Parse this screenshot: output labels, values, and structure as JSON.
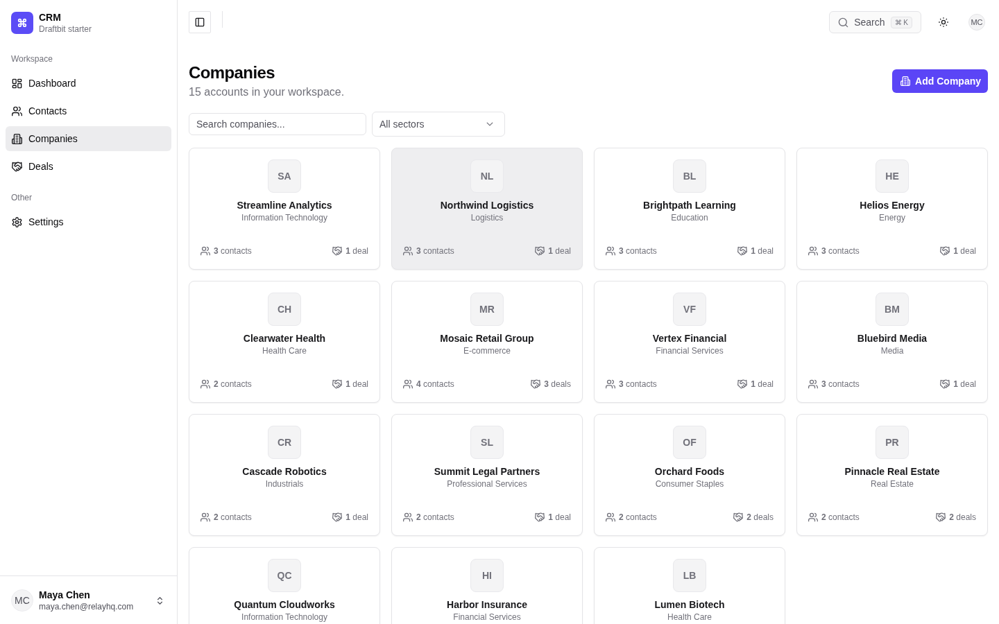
{
  "sidebar": {
    "brand": {
      "title": "CRM",
      "subtitle": "Draftbit starter"
    },
    "sections": [
      {
        "label": "Workspace",
        "items": [
          {
            "label": "Dashboard",
            "selected": false
          },
          {
            "label": "Contacts",
            "selected": false
          },
          {
            "label": "Companies",
            "selected": true
          },
          {
            "label": "Deals",
            "selected": false
          }
        ]
      },
      {
        "label": "Other",
        "items": [
          {
            "label": "Settings",
            "selected": false
          }
        ]
      }
    ],
    "user": {
      "initials": "MC",
      "name": "Maya Chen",
      "email": "maya.chen@relayhq.com"
    }
  },
  "topbar": {
    "search": {
      "label": "Search",
      "shortcut": "⌘ K"
    },
    "avatar": "MC"
  },
  "header": {
    "title": "Companies",
    "subtitle": "15 accounts in your workspace.",
    "action": "Add Company"
  },
  "filters": {
    "search": {
      "placeholder": "Search companies..."
    },
    "sector": {
      "value": "All sectors"
    }
  },
  "companies": [
    {
      "initials": "SA",
      "name": "Streamline Analytics",
      "sector": "Information Technology",
      "contacts": "**3** contacts",
      "deals": "**1** deal",
      "hovered": false
    },
    {
      "initials": "NL",
      "name": "Northwind Logistics",
      "sector": "Logistics",
      "contacts": "**3** contacts",
      "deals": "**1** deal",
      "hovered": true
    },
    {
      "initials": "BL",
      "name": "Brightpath Learning",
      "sector": "Education",
      "contacts": "**3** contacts",
      "deals": "**1** deal",
      "hovered": false
    },
    {
      "initials": "HE",
      "name": "Helios Energy",
      "sector": "Energy",
      "contacts": "**3** contacts",
      "deals": "**1** deal",
      "hovered": false
    },
    {
      "initials": "CH",
      "name": "Clearwater Health",
      "sector": "Health Care",
      "contacts": "**2** contacts",
      "deals": "**1** deal",
      "hovered": false
    },
    {
      "initials": "MR",
      "name": "Mosaic Retail Group",
      "sector": "E-commerce",
      "contacts": "**4** contacts",
      "deals": "**3** deals",
      "hovered": false
    },
    {
      "initials": "VF",
      "name": "Vertex Financial",
      "sector": "Financial Services",
      "contacts": "**3** contacts",
      "deals": "**1** deal",
      "hovered": false
    },
    {
      "initials": "BM",
      "name": "Bluebird Media",
      "sector": "Media",
      "contacts": "**3** contacts",
      "deals": "**1** deal",
      "hovered": false
    },
    {
      "initials": "CR",
      "name": "Cascade Robotics",
      "sector": "Industrials",
      "contacts": "**2** contacts",
      "deals": "**1** deal",
      "hovered": false
    },
    {
      "initials": "SL",
      "name": "Summit Legal Partners",
      "sector": "Professional Services",
      "contacts": "**2** contacts",
      "deals": "**1** deal",
      "hovered": false
    },
    {
      "initials": "OF",
      "name": "Orchard Foods",
      "sector": "Consumer Staples",
      "contacts": "**2** contacts",
      "deals": "**2** deals",
      "hovered": false
    },
    {
      "initials": "PR",
      "name": "Pinnacle Real Estate",
      "sector": "Real Estate",
      "contacts": "**2** contacts",
      "deals": "**2** deals",
      "hovered": false
    },
    {
      "initials": "QC",
      "name": "Quantum Cloudworks",
      "sector": "Information Technology",
      "hovered": false
    },
    {
      "initials": "HI",
      "name": "Harbor Insurance",
      "sector": "Financial Services",
      "hovered": false
    },
    {
      "initials": "LB",
      "name": "Lumen Biotech",
      "sector": "Health Care",
      "hovered": false
    }
  ]
}
